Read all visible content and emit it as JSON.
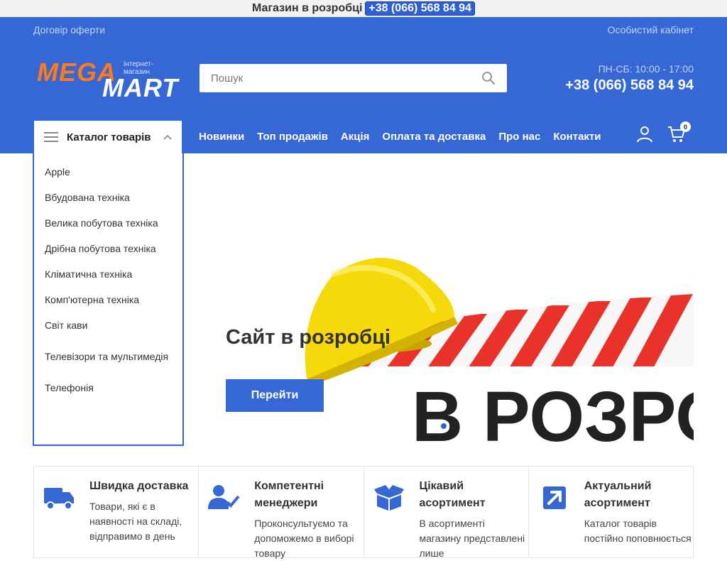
{
  "notice": {
    "text": "Магазин в розробці",
    "phone": "+38 (066) 568 84 94"
  },
  "topbar": {
    "offer_link": "Договір оферти",
    "account_link": "Особистий кабінет"
  },
  "logo": {
    "mega": "MEGA",
    "mart": "MART",
    "tagline": "інтернет-магазин"
  },
  "search": {
    "placeholder": "Пошук"
  },
  "contact": {
    "hours": "ПН-СБ: 10:00 - 17:00",
    "phone": "+38 (066) 568 84 94"
  },
  "catalog": {
    "button_label": "Каталог товарів",
    "items": [
      "Apple",
      "Вбудована техніка",
      "Велика побутова техніка",
      "Дрібна побутова техніка",
      "Кліматична техніка",
      "Комп'ютерна техніка",
      "Світ кави",
      "Телевізори та мультимедія",
      "Телефонія"
    ]
  },
  "nav": [
    "Новинки",
    "Топ продажів",
    "Акція",
    "Оплата та доставка",
    "Про нас",
    "Контакти"
  ],
  "cart": {
    "count": "0"
  },
  "hero": {
    "title": "Сайт в розробці",
    "button": "Перейти",
    "sign_text": "В РОЗРО"
  },
  "features": [
    {
      "icon": "truck-icon",
      "title": "Швидка доставка",
      "text": "Товари, які є в наявності на складі, відправимо в день"
    },
    {
      "icon": "manager-check-icon",
      "title": "Компетентні менеджери",
      "text": "Проконсультуємо та допоможемо в виборі товару"
    },
    {
      "icon": "box-icon",
      "title": "Цікавий асортимент",
      "text": "В асортименті магазину представлені лише"
    },
    {
      "icon": "arrow-up-right-icon",
      "title": "Актуальний асортимент",
      "text": "Каталог товарів постійно поповнюється"
    }
  ],
  "colors": {
    "primary": "#3568d4",
    "accent": "#ff7a1a"
  }
}
